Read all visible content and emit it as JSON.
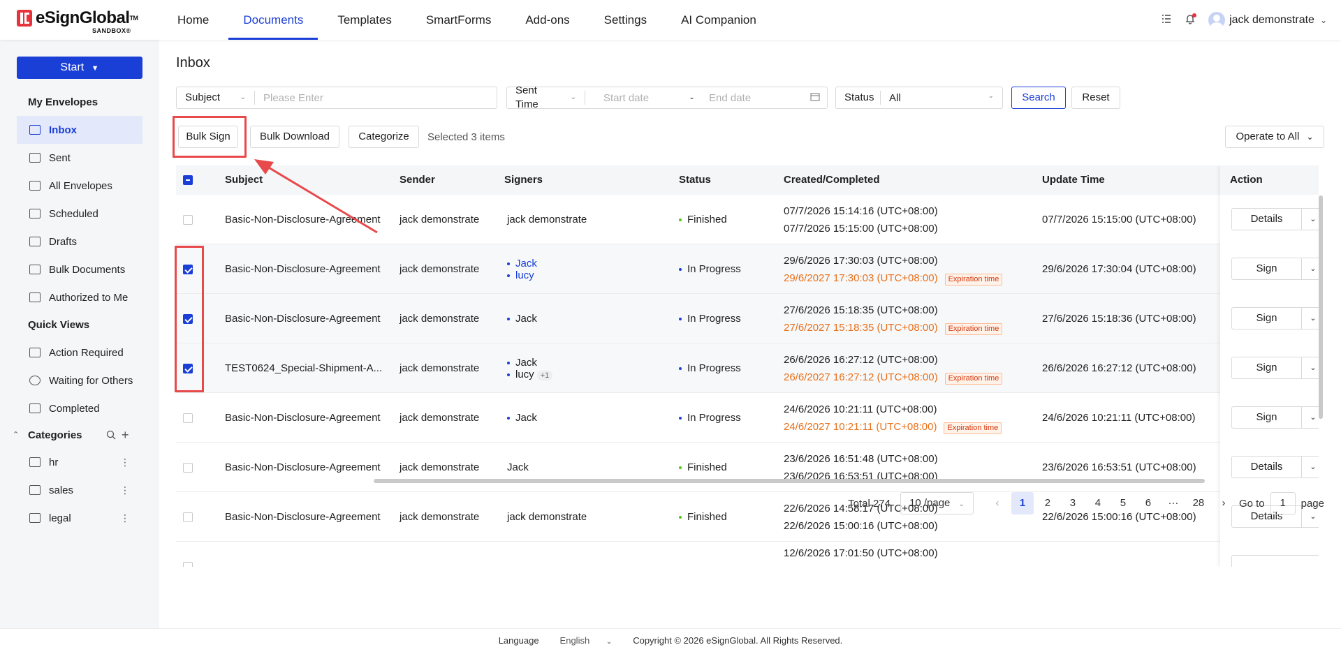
{
  "brand": {
    "name": "eSignGlobal",
    "tm": "TM",
    "sandbox": "SANDBOX®"
  },
  "nav": [
    {
      "label": "Home"
    },
    {
      "label": "Documents",
      "active": true
    },
    {
      "label": "Templates"
    },
    {
      "label": "SmartForms"
    },
    {
      "label": "Add-ons"
    },
    {
      "label": "Settings"
    },
    {
      "label": "AI Companion"
    }
  ],
  "user": {
    "name": "jack demonstrate"
  },
  "sidebar": {
    "start_label": "Start",
    "my_envelopes_title": "My Envelopes",
    "my_envelopes": [
      {
        "label": "Inbox",
        "active": true
      },
      {
        "label": "Sent"
      },
      {
        "label": "All Envelopes"
      },
      {
        "label": "Scheduled"
      },
      {
        "label": "Drafts"
      },
      {
        "label": "Bulk Documents"
      },
      {
        "label": "Authorized to Me"
      }
    ],
    "quick_views_title": "Quick Views",
    "quick_views": [
      {
        "label": "Action Required"
      },
      {
        "label": "Waiting for Others"
      },
      {
        "label": "Completed"
      }
    ],
    "categories_title": "Categories",
    "categories": [
      {
        "label": "hr"
      },
      {
        "label": "sales"
      },
      {
        "label": "legal"
      }
    ]
  },
  "page": {
    "title": "Inbox"
  },
  "filters": {
    "subject_label": "Subject",
    "subject_placeholder": "Please Enter",
    "time_label": "Sent Time",
    "start_placeholder": "Start date",
    "range_sep": "-",
    "end_placeholder": "End date",
    "status_label": "Status",
    "status_value": "All",
    "search_label": "Search",
    "reset_label": "Reset"
  },
  "toolbar": {
    "bulk_sign": "Bulk Sign",
    "bulk_download": "Bulk Download",
    "categorize": "Categorize",
    "selected_text": "Selected 3 items",
    "operate_all": "Operate to All"
  },
  "table": {
    "headers": {
      "subject": "Subject",
      "sender": "Sender",
      "signers": "Signers",
      "status": "Status",
      "created": "Created/Completed",
      "update": "Update Time",
      "action": "Action"
    },
    "expiration_tag": "Expiration time",
    "rows": [
      {
        "checked": false,
        "subject": "Basic-Non-Disclosure-Agreement",
        "sender": "jack demonstrate",
        "signers": [
          {
            "name": "jack demonstrate",
            "plain": true
          }
        ],
        "status": "Finished",
        "status_color": "#52c41a",
        "created": "07/7/2026 15:14:16 (UTC+08:00)",
        "completed": "07/7/2026 15:15:00 (UTC+08:00)",
        "expiring": false,
        "update": "07/7/2026 15:15:00 (UTC+08:00)",
        "action": "Details"
      },
      {
        "checked": true,
        "subject": "Basic-Non-Disclosure-Agreement",
        "sender": "jack demonstrate",
        "signers": [
          {
            "name": "Jack",
            "link": true
          },
          {
            "name": "lucy",
            "link": true
          }
        ],
        "status": "In Progress",
        "status_color": "#1a3fd6",
        "created": "29/6/2026 17:30:03 (UTC+08:00)",
        "completed": "29/6/2027 17:30:03 (UTC+08:00)",
        "expiring": true,
        "update": "29/6/2026 17:30:04 (UTC+08:00)",
        "action": "Sign"
      },
      {
        "checked": true,
        "subject": "Basic-Non-Disclosure-Agreement",
        "sender": "jack demonstrate",
        "signers": [
          {
            "name": "Jack"
          }
        ],
        "status": "In Progress",
        "status_color": "#1a3fd6",
        "created": "27/6/2026 15:18:35 (UTC+08:00)",
        "completed": "27/6/2027 15:18:35 (UTC+08:00)",
        "expiring": true,
        "update": "27/6/2026 15:18:36 (UTC+08:00)",
        "action": "Sign"
      },
      {
        "checked": true,
        "subject": "TEST0624_Special-Shipment-A...",
        "sender": "jack demonstrate",
        "signers": [
          {
            "name": "Jack"
          },
          {
            "name": "lucy",
            "extra": "+1"
          }
        ],
        "status": "In Progress",
        "status_color": "#1a3fd6",
        "created": "26/6/2026 16:27:12 (UTC+08:00)",
        "completed": "26/6/2027 16:27:12 (UTC+08:00)",
        "expiring": true,
        "update": "26/6/2026 16:27:12 (UTC+08:00)",
        "action": "Sign"
      },
      {
        "checked": false,
        "subject": "Basic-Non-Disclosure-Agreement",
        "sender": "jack demonstrate",
        "signers": [
          {
            "name": "Jack"
          }
        ],
        "status": "In Progress",
        "status_color": "#1a3fd6",
        "created": "24/6/2026 10:21:11 (UTC+08:00)",
        "completed": "24/6/2027 10:21:11 (UTC+08:00)",
        "expiring": true,
        "update": "24/6/2026 10:21:11 (UTC+08:00)",
        "action": "Sign"
      },
      {
        "checked": false,
        "subject": "Basic-Non-Disclosure-Agreement",
        "sender": "jack demonstrate",
        "signers": [
          {
            "name": "Jack",
            "plain": true
          }
        ],
        "status": "Finished",
        "status_color": "#52c41a",
        "created": "23/6/2026 16:51:48 (UTC+08:00)",
        "completed": "23/6/2026 16:53:51 (UTC+08:00)",
        "expiring": false,
        "update": "23/6/2026 16:53:51 (UTC+08:00)",
        "action": "Details"
      },
      {
        "checked": false,
        "subject": "Basic-Non-Disclosure-Agreement",
        "sender": "jack demonstrate",
        "signers": [
          {
            "name": "jack demonstrate",
            "plain": true
          }
        ],
        "status": "Finished",
        "status_color": "#52c41a",
        "created": "22/6/2026 14:58:17 (UTC+08:00)",
        "completed": "22/6/2026 15:00:16 (UTC+08:00)",
        "expiring": false,
        "update": "22/6/2026 15:00:16 (UTC+08:00)",
        "action": "Details"
      },
      {
        "checked": false,
        "subject": "",
        "sender": "",
        "signers": [],
        "status": "",
        "status_color": "#52c41a",
        "created": "12/6/2026 17:01:50 (UTC+08:00)",
        "completed": "",
        "expiring": false,
        "update": "",
        "action": ""
      }
    ]
  },
  "pagination": {
    "total": "Total 274",
    "page_size": "10 /page",
    "pages": [
      "1",
      "2",
      "3",
      "4",
      "5",
      "6",
      "···",
      "28"
    ],
    "current": "1",
    "goto_label": "Go to",
    "goto_value": "1",
    "page_label": "page"
  },
  "footer": {
    "language_label": "Language",
    "language_value": "English",
    "copyright": "Copyright © 2026 eSignGlobal. All Rights Reserved."
  }
}
